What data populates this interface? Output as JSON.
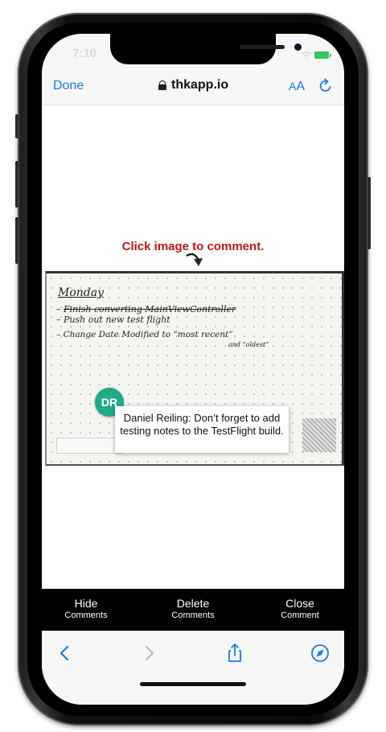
{
  "status": {
    "time": "7:10"
  },
  "browser": {
    "done_label": "Done",
    "url": "thkapp.io",
    "text_size_label_small": "A",
    "text_size_label_big": "A"
  },
  "page": {
    "hint": "Click image to comment.",
    "note": {
      "title": "Monday",
      "line1_prefix": "– ",
      "line1_struck": "Finish converting MainViewController",
      "line2": "– Push out new test flight",
      "line3": "– Change Date Modified  to  “most recent”",
      "line4": "and “oldest”"
    },
    "comment": {
      "avatar_initials": "DR",
      "text": "Daniel Reiling: Don’t forget to add testing notes to the TestFlight build."
    }
  },
  "actions": [
    {
      "line1": "Hide",
      "line2": "Comments"
    },
    {
      "line1": "Delete",
      "line2": "Comments"
    },
    {
      "line1": "Close",
      "line2": "Comment"
    }
  ],
  "colors": {
    "accent": "#1a7ce8",
    "hint": "#c4161c",
    "avatar": "#1faa89"
  }
}
